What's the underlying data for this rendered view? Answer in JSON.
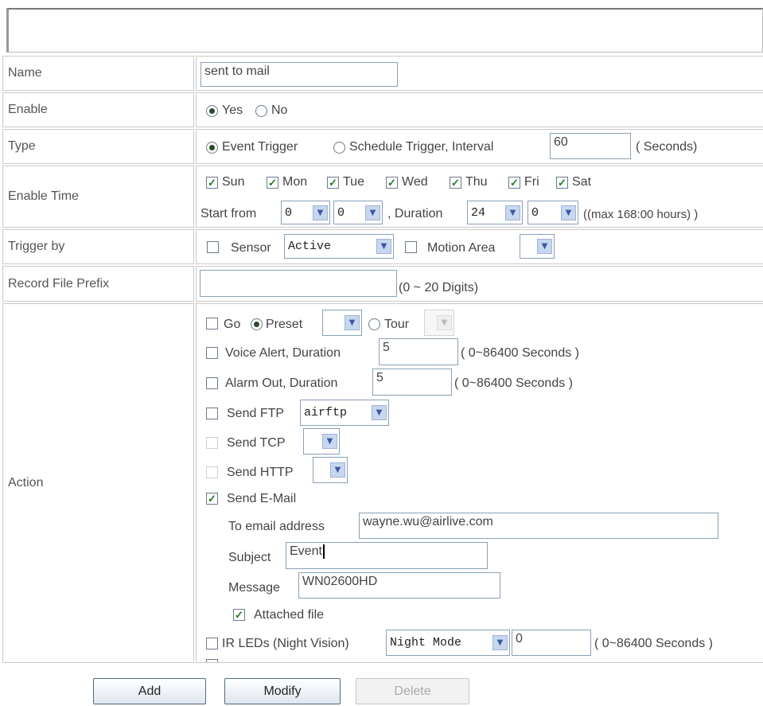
{
  "labels": {
    "name": "Name",
    "enable": "Enable",
    "type": "Type",
    "enable_time": "Enable Time",
    "trigger_by": "Trigger by",
    "record_prefix": "Record File Prefix",
    "action": "Action"
  },
  "name_value": "sent to mail",
  "enable": {
    "yes": "Yes",
    "no": "No",
    "selected": "Yes"
  },
  "type": {
    "event": "Event Trigger",
    "schedule": "Schedule Trigger, Interval",
    "interval_value": "60",
    "unit": "( Seconds)",
    "selected": "Event Trigger"
  },
  "days": [
    {
      "label": "Sun",
      "checked": true
    },
    {
      "label": "Mon",
      "checked": true
    },
    {
      "label": "Tue",
      "checked": true
    },
    {
      "label": "Wed",
      "checked": true
    },
    {
      "label": "Thu",
      "checked": true
    },
    {
      "label": "Fri",
      "checked": true
    },
    {
      "label": "Sat",
      "checked": true
    }
  ],
  "time": {
    "start_label": "Start from",
    "start_hour": "0",
    "start_min": "0",
    "duration_label": ", Duration",
    "dur_hour": "24",
    "dur_min": "0",
    "max_note": "((max 168:00 hours) )"
  },
  "trigger": {
    "sensor_label": "Sensor",
    "sensor_value": "Active",
    "motion_label": "Motion Area",
    "motion_value": ""
  },
  "record_prefix": {
    "value": "",
    "note": "(0 ~ 20 Digits)"
  },
  "action": {
    "go": {
      "label": "Go",
      "preset_label": "Preset",
      "tour_label": "Tour"
    },
    "voice": {
      "label": "Voice Alert, Duration",
      "value": "5",
      "note": "( 0~86400 Seconds )"
    },
    "alarm": {
      "label": "Alarm Out, Duration",
      "value": "5",
      "note": "( 0~86400 Seconds )"
    },
    "ftp": {
      "label": "Send FTP",
      "value": "airftp"
    },
    "tcp": {
      "label": "Send TCP",
      "value": ""
    },
    "http": {
      "label": "Send HTTP",
      "value": ""
    },
    "email": {
      "label": "Send E-Mail",
      "to_label": "To email address",
      "to_value": "wayne.wu@airlive.com",
      "subject_label": "Subject",
      "subject_value": "Event",
      "message_label": "Message",
      "message_value": "WN02600HD",
      "attached_label": "Attached file"
    },
    "ir": {
      "label": "IR LEDs (Night Vision)",
      "mode_value": "Night Mode",
      "value": "0",
      "note": "( 0~86400 Seconds )"
    }
  },
  "buttons": {
    "add": "Add",
    "modify": "Modify",
    "delete": "Delete"
  },
  "icons": {
    "checkmark": "✓",
    "dropdown_arrow": "▼"
  }
}
